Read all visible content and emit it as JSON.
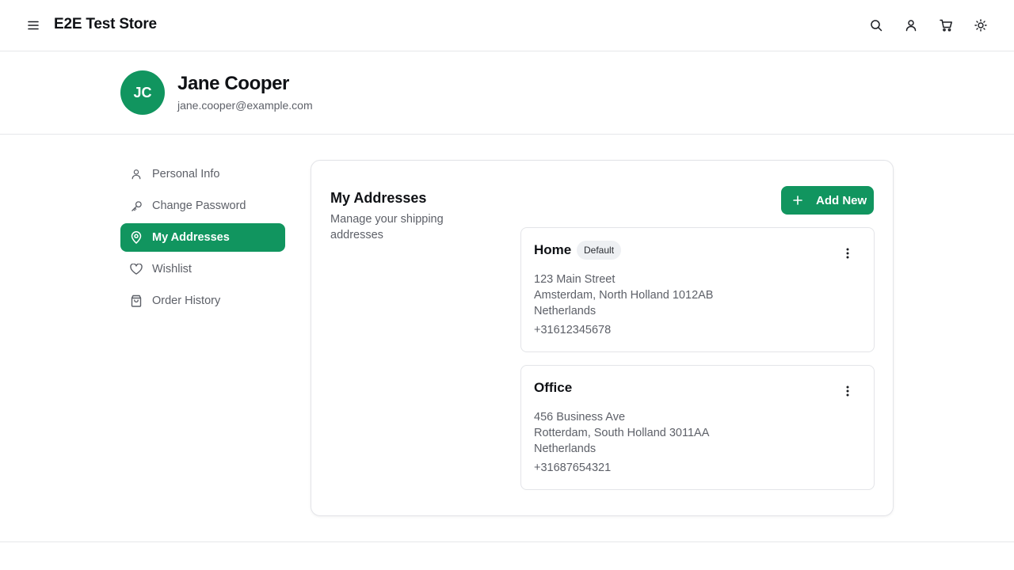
{
  "header": {
    "brand": "E2E Test Store",
    "icons": [
      "menu-icon",
      "search-icon",
      "user-icon",
      "cart-icon",
      "sun-icon"
    ]
  },
  "profile": {
    "initials": "JC",
    "name": "Jane Cooper",
    "email": "jane.cooper@example.com",
    "avatar_color": "#11955f"
  },
  "sidebar": {
    "items": [
      {
        "label": "Personal Info",
        "icon": "user-icon",
        "active": false
      },
      {
        "label": "Change Password",
        "icon": "key-icon",
        "active": false
      },
      {
        "label": "My Addresses",
        "icon": "map-pin-icon",
        "active": true
      },
      {
        "label": "Wishlist",
        "icon": "heart-icon",
        "active": false
      },
      {
        "label": "Order History",
        "icon": "shopping-bag-icon",
        "active": false
      }
    ]
  },
  "main": {
    "title": "My Addresses",
    "subtitle": "Manage your shipping addresses",
    "add_label": "Add New",
    "addresses": [
      {
        "name": "Home",
        "badge": "Default",
        "street": "123 Main Street",
        "city_line": "Amsterdam, North Holland 1012AB",
        "country": "Netherlands",
        "phone": "+31612345678"
      },
      {
        "name": "Office",
        "badge": "",
        "street": "456 Business Ave",
        "city_line": "Rotterdam, South Holland 3011AA",
        "country": "Netherlands",
        "phone": "+31687654321"
      }
    ]
  },
  "colors": {
    "accent": "#11955f",
    "text": "#0f1115",
    "muted": "#5d6068",
    "border": "#e3e4e8"
  }
}
